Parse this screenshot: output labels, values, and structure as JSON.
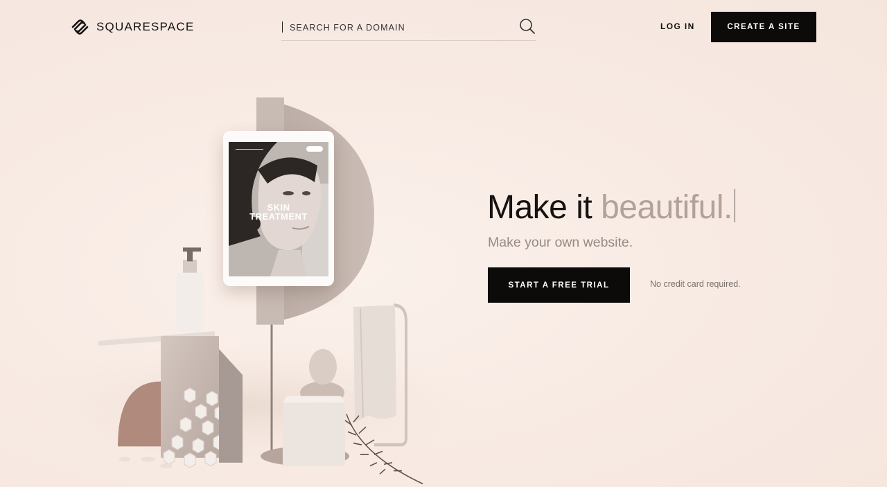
{
  "brand": {
    "name": "SQUARESPACE"
  },
  "header": {
    "search_placeholder": "SEARCH FOR A DOMAIN",
    "login_label": "LOG IN",
    "create_label": "CREATE A SITE"
  },
  "hero": {
    "headline_dark": "Make it",
    "headline_light": "beautiful.",
    "subheading": "Make your own website.",
    "cta_label": "START A FREE TRIAL",
    "cta_note": "No credit card required."
  },
  "tablet": {
    "screen_line1": "SKIN",
    "screen_line2": "TREATMENT"
  },
  "colors": {
    "background": "#f8ebe3",
    "button": "#0d0b0a",
    "headline_accent": "#b3a29b"
  }
}
